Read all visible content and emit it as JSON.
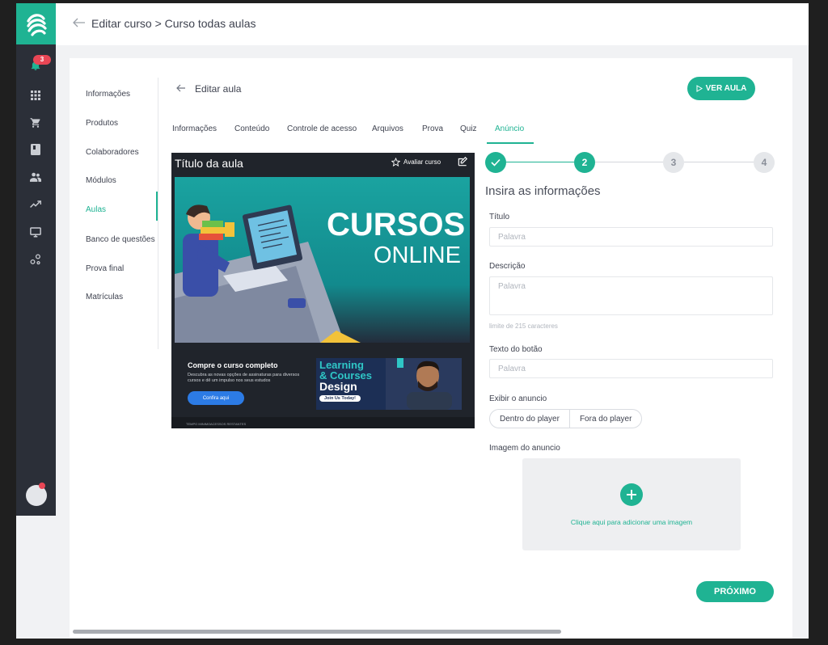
{
  "topbar": {
    "breadcrumb": "Editar curso > Curso todas aulas"
  },
  "rail": {
    "notification_count": "3",
    "icons": [
      "bell-icon",
      "grid-icon",
      "cart-icon",
      "book-icon",
      "users-icon",
      "trending-up-icon",
      "monitor-icon",
      "share-icon"
    ]
  },
  "left_nav": {
    "items": [
      {
        "label": "Informações"
      },
      {
        "label": "Produtos"
      },
      {
        "label": "Colaboradores"
      },
      {
        "label": "Módulos"
      },
      {
        "label": "Aulas"
      },
      {
        "label": "Banco de questões"
      },
      {
        "label": "Prova final"
      },
      {
        "label": "Matrículas"
      }
    ],
    "active_index": 4
  },
  "header": {
    "title": "Editar aula",
    "view_button": "VER AULA"
  },
  "tabs": [
    {
      "label": "Informações"
    },
    {
      "label": "Conteúdo"
    },
    {
      "label": "Controle de acesso"
    },
    {
      "label": "Arquivos"
    },
    {
      "label": "Prova"
    },
    {
      "label": "Quiz"
    },
    {
      "label": "Anúncio"
    }
  ],
  "active_tab": "Anúncio",
  "preview": {
    "title": "Título da aula",
    "rate_label": "Avaliar curso",
    "banner_line1": "CURSOS",
    "banner_line2": "ONLINE",
    "promo_title": "Compre o curso completo",
    "promo_text": "Descubra as novas opções de assinaturas para diversos cursos e dê um impulso nos seus estudos",
    "promo_button": "Confira aqui",
    "ad_line1": "Learning",
    "ad_line2": "& Courses",
    "ad_line3": "Design",
    "ad_button": "Join Us Today!",
    "footer_left": "TEMPO MINIMO",
    "footer_mid": "ACESSOS RESTANTES"
  },
  "stepper": {
    "steps": [
      "",
      "2",
      "3",
      "4"
    ],
    "current": 2
  },
  "form": {
    "heading": "Insira as informações",
    "title_label": "Título",
    "title_placeholder": "Palavra",
    "description_label": "Descrição",
    "description_placeholder": "Palavra",
    "description_limit": "limite de 215 caracteres",
    "button_text_label": "Texto do botão",
    "button_text_placeholder": "Palavra",
    "display_label": "Exibir o anuncio",
    "display_options": [
      "Dentro do player",
      "Fora do player"
    ],
    "image_label": "Imagem do anuncio",
    "image_hint": "Clique aqui para adicionar uma imagem",
    "next_button": "PRÓXIMO"
  },
  "colors": {
    "accent": "#1fb393",
    "rail": "#2b2f38",
    "badge": "#e94655"
  }
}
